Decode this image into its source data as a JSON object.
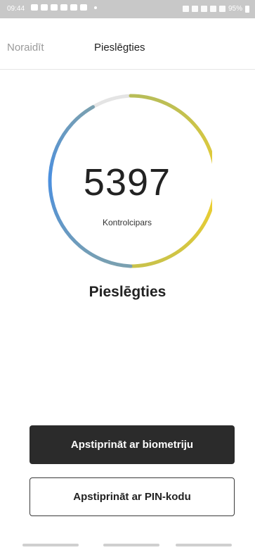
{
  "status_bar": {
    "time": "09:44",
    "battery": "95%",
    "notification_icons": [
      "message-icon",
      "app-icon",
      "app-icon",
      "app-icon",
      "app-icon",
      "app-icon"
    ],
    "system_icons": [
      "alarm-icon",
      "bluetooth-icon",
      "wifi-icon",
      "signal-icon",
      "signal-icon"
    ]
  },
  "nav": {
    "dismiss_label": "Noraidīt",
    "title": "Pieslēgties"
  },
  "verification": {
    "code": "5397",
    "code_label": "Kontrolcipars",
    "ring_colors": [
      "#4a8fe0",
      "#7aa0b0",
      "#b8bd58",
      "#f3d12b",
      "#e4e4e4"
    ]
  },
  "heading": "Pieslēgties",
  "actions": {
    "biometric_label": "Apstiprināt ar biometriju",
    "pin_label": "Apstiprināt ar PIN-kodu"
  }
}
